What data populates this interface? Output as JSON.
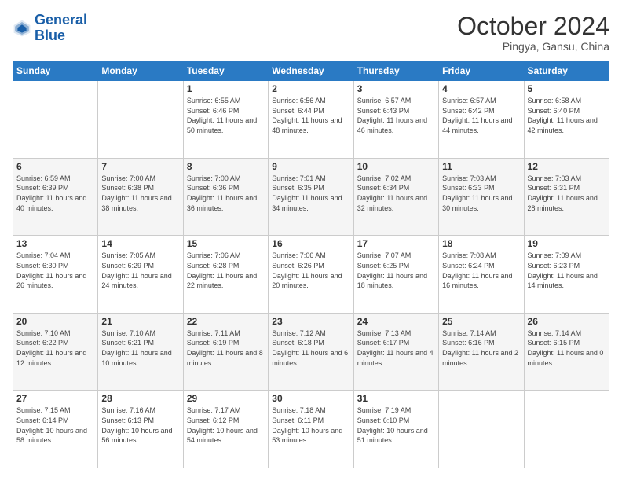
{
  "logo": {
    "line1": "General",
    "line2": "Blue"
  },
  "header": {
    "month": "October 2024",
    "location": "Pingya, Gansu, China"
  },
  "weekdays": [
    "Sunday",
    "Monday",
    "Tuesday",
    "Wednesday",
    "Thursday",
    "Friday",
    "Saturday"
  ],
  "weeks": [
    [
      {
        "day": "",
        "text": ""
      },
      {
        "day": "",
        "text": ""
      },
      {
        "day": "1",
        "text": "Sunrise: 6:55 AM\nSunset: 6:46 PM\nDaylight: 11 hours and 50 minutes."
      },
      {
        "day": "2",
        "text": "Sunrise: 6:56 AM\nSunset: 6:44 PM\nDaylight: 11 hours and 48 minutes."
      },
      {
        "day": "3",
        "text": "Sunrise: 6:57 AM\nSunset: 6:43 PM\nDaylight: 11 hours and 46 minutes."
      },
      {
        "day": "4",
        "text": "Sunrise: 6:57 AM\nSunset: 6:42 PM\nDaylight: 11 hours and 44 minutes."
      },
      {
        "day": "5",
        "text": "Sunrise: 6:58 AM\nSunset: 6:40 PM\nDaylight: 11 hours and 42 minutes."
      }
    ],
    [
      {
        "day": "6",
        "text": "Sunrise: 6:59 AM\nSunset: 6:39 PM\nDaylight: 11 hours and 40 minutes."
      },
      {
        "day": "7",
        "text": "Sunrise: 7:00 AM\nSunset: 6:38 PM\nDaylight: 11 hours and 38 minutes."
      },
      {
        "day": "8",
        "text": "Sunrise: 7:00 AM\nSunset: 6:36 PM\nDaylight: 11 hours and 36 minutes."
      },
      {
        "day": "9",
        "text": "Sunrise: 7:01 AM\nSunset: 6:35 PM\nDaylight: 11 hours and 34 minutes."
      },
      {
        "day": "10",
        "text": "Sunrise: 7:02 AM\nSunset: 6:34 PM\nDaylight: 11 hours and 32 minutes."
      },
      {
        "day": "11",
        "text": "Sunrise: 7:03 AM\nSunset: 6:33 PM\nDaylight: 11 hours and 30 minutes."
      },
      {
        "day": "12",
        "text": "Sunrise: 7:03 AM\nSunset: 6:31 PM\nDaylight: 11 hours and 28 minutes."
      }
    ],
    [
      {
        "day": "13",
        "text": "Sunrise: 7:04 AM\nSunset: 6:30 PM\nDaylight: 11 hours and 26 minutes."
      },
      {
        "day": "14",
        "text": "Sunrise: 7:05 AM\nSunset: 6:29 PM\nDaylight: 11 hours and 24 minutes."
      },
      {
        "day": "15",
        "text": "Sunrise: 7:06 AM\nSunset: 6:28 PM\nDaylight: 11 hours and 22 minutes."
      },
      {
        "day": "16",
        "text": "Sunrise: 7:06 AM\nSunset: 6:26 PM\nDaylight: 11 hours and 20 minutes."
      },
      {
        "day": "17",
        "text": "Sunrise: 7:07 AM\nSunset: 6:25 PM\nDaylight: 11 hours and 18 minutes."
      },
      {
        "day": "18",
        "text": "Sunrise: 7:08 AM\nSunset: 6:24 PM\nDaylight: 11 hours and 16 minutes."
      },
      {
        "day": "19",
        "text": "Sunrise: 7:09 AM\nSunset: 6:23 PM\nDaylight: 11 hours and 14 minutes."
      }
    ],
    [
      {
        "day": "20",
        "text": "Sunrise: 7:10 AM\nSunset: 6:22 PM\nDaylight: 11 hours and 12 minutes."
      },
      {
        "day": "21",
        "text": "Sunrise: 7:10 AM\nSunset: 6:21 PM\nDaylight: 11 hours and 10 minutes."
      },
      {
        "day": "22",
        "text": "Sunrise: 7:11 AM\nSunset: 6:19 PM\nDaylight: 11 hours and 8 minutes."
      },
      {
        "day": "23",
        "text": "Sunrise: 7:12 AM\nSunset: 6:18 PM\nDaylight: 11 hours and 6 minutes."
      },
      {
        "day": "24",
        "text": "Sunrise: 7:13 AM\nSunset: 6:17 PM\nDaylight: 11 hours and 4 minutes."
      },
      {
        "day": "25",
        "text": "Sunrise: 7:14 AM\nSunset: 6:16 PM\nDaylight: 11 hours and 2 minutes."
      },
      {
        "day": "26",
        "text": "Sunrise: 7:14 AM\nSunset: 6:15 PM\nDaylight: 11 hours and 0 minutes."
      }
    ],
    [
      {
        "day": "27",
        "text": "Sunrise: 7:15 AM\nSunset: 6:14 PM\nDaylight: 10 hours and 58 minutes."
      },
      {
        "day": "28",
        "text": "Sunrise: 7:16 AM\nSunset: 6:13 PM\nDaylight: 10 hours and 56 minutes."
      },
      {
        "day": "29",
        "text": "Sunrise: 7:17 AM\nSunset: 6:12 PM\nDaylight: 10 hours and 54 minutes."
      },
      {
        "day": "30",
        "text": "Sunrise: 7:18 AM\nSunset: 6:11 PM\nDaylight: 10 hours and 53 minutes."
      },
      {
        "day": "31",
        "text": "Sunrise: 7:19 AM\nSunset: 6:10 PM\nDaylight: 10 hours and 51 minutes."
      },
      {
        "day": "",
        "text": ""
      },
      {
        "day": "",
        "text": ""
      }
    ]
  ]
}
